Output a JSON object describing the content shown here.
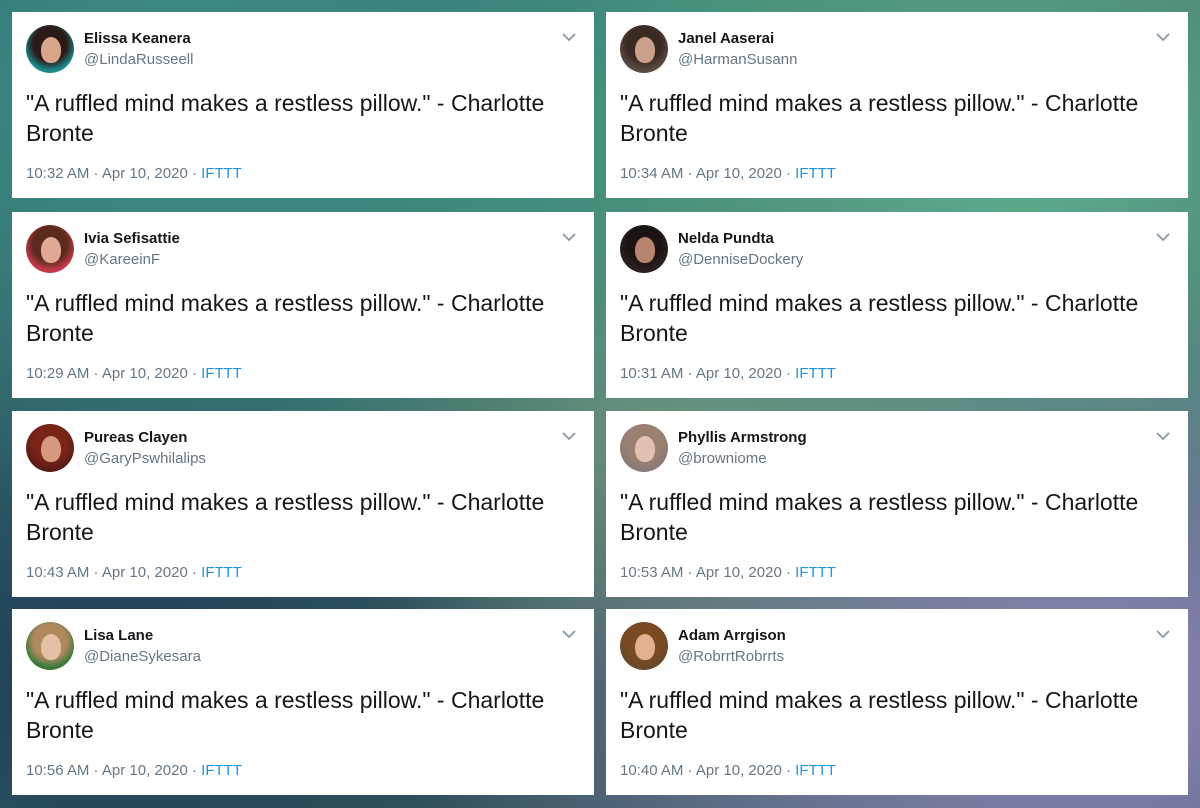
{
  "tweets": [
    {
      "name": "Elissa Keanera",
      "handle": "@LindaRusseell",
      "text": "\"A ruffled mind makes a restless pillow.\" - Charlotte Bronte",
      "time": "10:32 AM",
      "date": "Apr 10, 2020",
      "source": "IFTTT",
      "avatar": {
        "hair": "#2b1a17",
        "skin": "#d8a58a",
        "bg": "#1a8a8a"
      }
    },
    {
      "name": "Janel Aaserai",
      "handle": "@HarmanSusann",
      "text": "\"A ruffled mind makes a restless pillow.\" - Charlotte Bronte",
      "time": "10:34 AM",
      "date": "Apr 10, 2020",
      "source": "IFTTT",
      "avatar": {
        "hair": "#3a2a22",
        "skin": "#caa08a",
        "bg": "#5a4a44"
      }
    },
    {
      "name": "Ivia Sefisattie",
      "handle": "@KareeinF",
      "text": "\"A ruffled mind makes a restless pillow.\" - Charlotte Bronte",
      "time": "10:29 AM",
      "date": "Apr 10, 2020",
      "source": "IFTTT",
      "avatar": {
        "hair": "#5a2a1c",
        "skin": "#e0a996",
        "bg": "#c43a4a"
      }
    },
    {
      "name": "Nelda Pundta",
      "handle": "@DenniseDockery",
      "text": "\"A ruffled mind makes a restless pillow.\" - Charlotte Bronte",
      "time": "10:31 AM",
      "date": "Apr 10, 2020",
      "source": "IFTTT",
      "avatar": {
        "hair": "#1c1412",
        "skin": "#b88470",
        "bg": "#2b2020"
      }
    },
    {
      "name": "Pureas Clayen",
      "handle": "@GaryPswhilalips",
      "text": "\"A ruffled mind makes a restless pillow.\" - Charlotte Bronte",
      "time": "10:43 AM",
      "date": "Apr 10, 2020",
      "source": "IFTTT",
      "avatar": {
        "hair": "#7a2418",
        "skin": "#d89880",
        "bg": "#5a1c16"
      }
    },
    {
      "name": "Phyllis Armstrong",
      "handle": "@browniome",
      "text": "\"A ruffled mind makes a restless pillow.\" - Charlotte Bronte",
      "time": "10:53 AM",
      "date": "Apr 10, 2020",
      "source": "IFTTT",
      "avatar": {
        "hair": "#9a8070",
        "skin": "#e2c0b0",
        "bg": "#8a7a78"
      }
    },
    {
      "name": "Lisa Lane",
      "handle": "@DianeSykesara",
      "text": "\"A ruffled mind makes a restless pillow.\" - Charlotte Bronte",
      "time": "10:56 AM",
      "date": "Apr 10, 2020",
      "source": "IFTTT",
      "avatar": {
        "hair": "#b08860",
        "skin": "#e4c0a4",
        "bg": "#3a7a3a"
      }
    },
    {
      "name": "Adam Arrgison",
      "handle": "@RobrrtRobrrts",
      "text": "\"A ruffled mind makes a restless pillow.\" - Charlotte Bronte",
      "time": "10:40 AM",
      "date": "Apr 10, 2020",
      "source": "IFTTT",
      "avatar": {
        "hair": "#7a4a22",
        "skin": "#e0b090",
        "bg": "#6a4a2a"
      }
    }
  ],
  "icons": {
    "avatar": "profile-photo",
    "menu": "chevron-down-icon"
  },
  "colors": {
    "name": "#14171a",
    "muted": "#657786",
    "link": "#1b95e0",
    "card": "#ffffff"
  }
}
